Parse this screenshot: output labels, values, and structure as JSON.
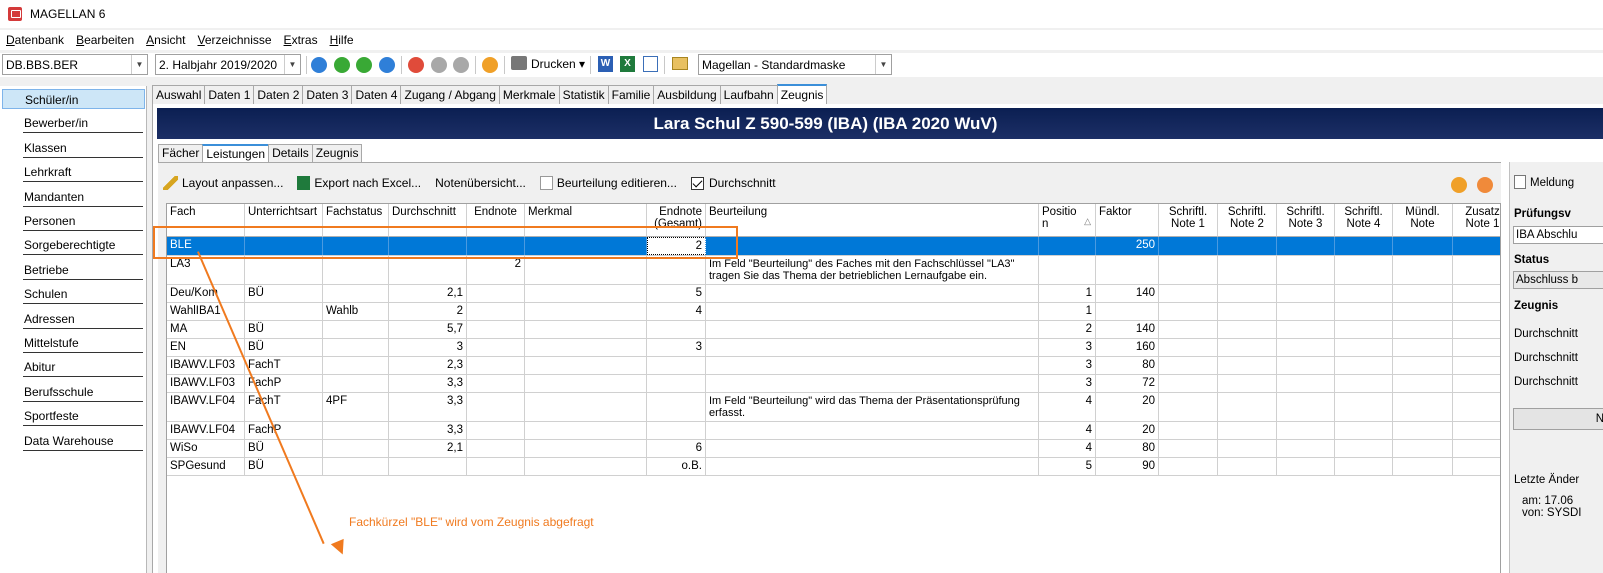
{
  "window": {
    "title": "MAGELLAN 6"
  },
  "menu": [
    {
      "label": "Datenbank",
      "acc": "D",
      "rest": "atenbank"
    },
    {
      "label": "Bearbeiten",
      "acc": "B",
      "rest": "earbeiten"
    },
    {
      "label": "Ansicht",
      "acc": "A",
      "rest": "nsicht"
    },
    {
      "label": "Verzeichnisse",
      "acc": "V",
      "rest": "erzeichnisse"
    },
    {
      "label": "Extras",
      "acc": "E",
      "rest": "xtras"
    },
    {
      "label": "Hilfe",
      "acc": "H",
      "rest": "ilfe"
    }
  ],
  "toolbar": {
    "db_combo": "DB.BBS.BER",
    "period_combo": "2. Halbjahr 2019/2020",
    "print_label": "Drucken",
    "mask_combo": "Magellan - Standardmaske",
    "colors": {
      "blue": "#2f7fd8",
      "green": "#39a935",
      "red": "#e04b3a",
      "grey": "#a8a8a8",
      "orange": "#f0a028"
    }
  },
  "sidebar": {
    "items": [
      "Schüler/in",
      "Bewerber/in",
      "Klassen",
      "Lehrkraft",
      "Mandanten",
      "Personen",
      "Sorgeberechtigte",
      "Betriebe",
      "Schulen",
      "Adressen",
      "Mittelstufe",
      "Abitur",
      "Berufsschule",
      "Sportfeste",
      "Data Warehouse"
    ],
    "active": "Schüler/in"
  },
  "tabs": [
    "Auswahl",
    "Daten 1",
    "Daten 2",
    "Daten 3",
    "Daten 4",
    "Zugang / Abgang",
    "Merkmale",
    "Statistik",
    "Familie",
    "Ausbildung",
    "Laufbahn",
    "Zeugnis"
  ],
  "active_tab": "Zeugnis",
  "header": {
    "title": "Lara Schul Z 590-599 (IBA) (IBA 2020 WuV)"
  },
  "subtabs": [
    "Fächer",
    "Leistungen",
    "Details",
    "Zeugnis"
  ],
  "active_subtab": "Leistungen",
  "actions": {
    "layout": "Layout anpassen...",
    "export": "Export nach Excel...",
    "notes": "Notenübersicht...",
    "beurteilung": "Beurteilung editieren...",
    "durchschnitt": "Durchschnitt"
  },
  "grid": {
    "headers": {
      "fach": "Fach",
      "unterrichtsart": "Unterrichtsart",
      "fachstatus": "Fachstatus",
      "durchschnitt": "Durchschnitt",
      "endnote": "Endnote",
      "merkmal": "Merkmal",
      "endnote_gesamt_1": "Endnote",
      "endnote_gesamt_2": "(Gesamt)",
      "beurteilung": "Beurteilung",
      "position_1": "Positio",
      "position_2": "n",
      "faktor": "Faktor",
      "sn1_1": "Schriftl.",
      "sn1_2": "Note 1",
      "sn2_1": "Schriftl.",
      "sn2_2": "Note 2",
      "sn3_1": "Schriftl.",
      "sn3_2": "Note 3",
      "sn4_1": "Schriftl.",
      "sn4_2": "Note 4",
      "mn_1": "Mündl.",
      "mn_2": "Note",
      "zn_1": "Zusatz",
      "zn_2": "Note 1"
    },
    "rows": [
      {
        "fach": "BLE",
        "ua": "",
        "fs": "",
        "ds": "",
        "en": "",
        "mm": "",
        "eg": "2",
        "bt": "",
        "pos": "",
        "fk": "250"
      },
      {
        "fach": "LA3",
        "ua": "",
        "fs": "",
        "ds": "",
        "en": "2",
        "mm": "",
        "eg": "",
        "bt": "Im Feld \"Beurteilung\" des Faches mit den Fachschlüssel \"LA3\" tragen Sie das Thema der betrieblichen Lernaufgabe ein.",
        "pos": "",
        "fk": ""
      },
      {
        "fach": "Deu/Kom",
        "ua": "BÜ",
        "fs": "",
        "ds": "2,1",
        "en": "",
        "mm": "",
        "eg": "5",
        "bt": "",
        "pos": "1",
        "fk": "140"
      },
      {
        "fach": "WahlIBA1",
        "ua": "",
        "fs": "Wahlb",
        "ds": "2",
        "en": "",
        "mm": "",
        "eg": "4",
        "bt": "",
        "pos": "1",
        "fk": ""
      },
      {
        "fach": "MA",
        "ua": "BÜ",
        "fs": "",
        "ds": "5,7",
        "en": "",
        "mm": "",
        "eg": "",
        "bt": "",
        "pos": "2",
        "fk": "140"
      },
      {
        "fach": "EN",
        "ua": "BÜ",
        "fs": "",
        "ds": "3",
        "en": "",
        "mm": "",
        "eg": "3",
        "bt": "",
        "pos": "3",
        "fk": "160"
      },
      {
        "fach": "IBAWV.LF03",
        "ua": "FachT",
        "fs": "",
        "ds": "2,3",
        "en": "",
        "mm": "",
        "eg": "",
        "bt": "",
        "pos": "3",
        "fk": "80"
      },
      {
        "fach": "IBAWV.LF03",
        "ua": "FachP",
        "fs": "",
        "ds": "3,3",
        "en": "",
        "mm": "",
        "eg": "",
        "bt": "",
        "pos": "3",
        "fk": "72"
      },
      {
        "fach": "IBAWV.LF04",
        "ua": "FachT",
        "fs": "4PF",
        "ds": "3,3",
        "en": "",
        "mm": "",
        "eg": "",
        "bt": "Im Feld \"Beurteilung\" wird das Thema der Präsentationsprüfung erfasst.",
        "pos": "4",
        "fk": "20"
      },
      {
        "fach": "IBAWV.LF04",
        "ua": "FachP",
        "fs": "",
        "ds": "3,3",
        "en": "",
        "mm": "",
        "eg": "",
        "bt": "",
        "pos": "4",
        "fk": "20"
      },
      {
        "fach": "WiSo",
        "ua": "BÜ",
        "fs": "",
        "ds": "2,1",
        "en": "",
        "mm": "",
        "eg": "6",
        "bt": "",
        "pos": "4",
        "fk": "80"
      },
      {
        "fach": "SPGesund",
        "ua": "BÜ",
        "fs": "",
        "ds": "",
        "en": "",
        "mm": "",
        "eg": "o.B.",
        "bt": "",
        "pos": "5",
        "fk": "90"
      }
    ]
  },
  "rpanel": {
    "meldung": "Meldung",
    "pruefung_label": "Prüfungsv",
    "pruefung_value": "IBA Abschlu",
    "status_label": "Status",
    "status_value": "Abschluss b",
    "zeugnis_label": "Zeugnis",
    "ds1": "Durchschnitt",
    "ds2": "Durchschnitt",
    "ds3": "Durchschnitt",
    "btn": "N",
    "letzte": "Letzte Änder",
    "am": "am:  17.06",
    "von": "von: SYSDI"
  },
  "annotation": {
    "text": "Fachkürzel \"BLE\" wird vom Zeugnis abgefragt",
    "color": "#f07a1f"
  }
}
